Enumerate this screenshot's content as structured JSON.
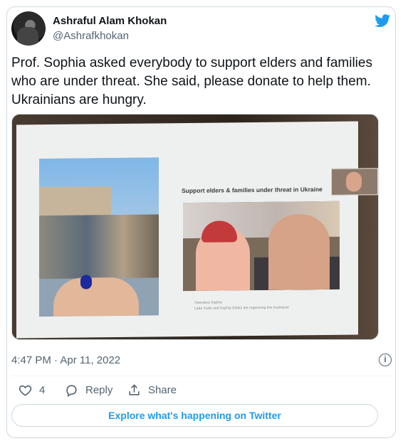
{
  "tweet": {
    "author_name": "Ashraful Alam Khokan",
    "author_handle": "@Ashrafkhokan",
    "text": "Prof. Sophia asked everybody to support elders and families who are under threat. She said, please donate to help them. Ukrainians are hungry.",
    "timestamp": "4:47 PM · Apr 11, 2022",
    "likes_count": "4",
    "reply_label": "Reply",
    "share_label": "Share",
    "explore_label": "Explore what's happening on Twitter"
  },
  "media": {
    "slide_title": "Support elders & families under threat in Ukraine",
    "caption_line1": "Yaroslava Sophia",
    "caption_line2": "Lada Yudin and Sophia Sobko are organizing this fundraiser"
  },
  "colors": {
    "brand": "#1d9bf0",
    "text": "#0f1419",
    "muted": "#536471",
    "border": "#cfd9de"
  },
  "icons": {
    "brand": "twitter-bird-icon",
    "like": "heart-icon",
    "reply": "reply-bubble-icon",
    "share": "share-icon",
    "info": "info-icon"
  }
}
